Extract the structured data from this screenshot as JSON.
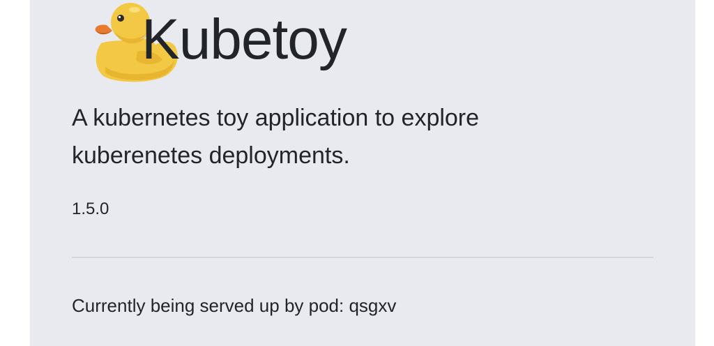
{
  "app": {
    "title": "Kubetoy",
    "logo_icon": "rubber-duck-icon",
    "description": "A kubernetes toy application to explore kuberenetes deployments.",
    "version": "1.5.0",
    "served_by": "Currently being served up by pod: qsgxv"
  },
  "colors": {
    "page_background": "#ffffff",
    "panel_background": "#e9eaef",
    "text": "#212529",
    "divider": "#d3d4d9",
    "duck_body": "#f2c844",
    "duck_beak": "#e87a2f"
  }
}
